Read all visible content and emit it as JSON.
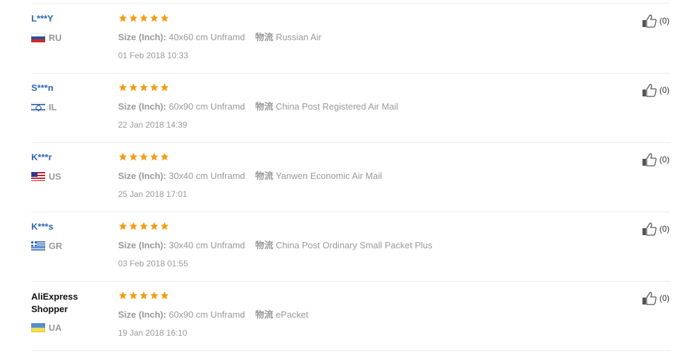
{
  "reviews": [
    {
      "user": "L***Y",
      "country": "RU",
      "flag": "ru-flag-icon",
      "rating": 5,
      "size_label": "Size (Inch):",
      "size_value": "40x60 cm Unframd",
      "logistics_label": "物流",
      "logistics_value": "Russian Air",
      "date": "01 Feb 2018 10:33",
      "helpful": "(0)"
    },
    {
      "user": "S***n",
      "country": "IL",
      "flag": "il-flag-icon",
      "rating": 5,
      "size_label": "Size (Inch):",
      "size_value": "60x90 cm Unframd",
      "logistics_label": "物流",
      "logistics_value": "China Post Registered Air Mail",
      "date": "22 Jan 2018 14:39",
      "helpful": "(0)"
    },
    {
      "user": "K***r",
      "country": "US",
      "flag": "us-flag-icon",
      "rating": 5,
      "size_label": "Size (Inch):",
      "size_value": "30x40 cm Unframd",
      "logistics_label": "物流",
      "logistics_value": "Yanwen Economic Air Mail",
      "date": "25 Jan 2018 17:01",
      "helpful": "(0)"
    },
    {
      "user": "K***s",
      "country": "GR",
      "flag": "gr-flag-icon",
      "rating": 5,
      "size_label": "Size (Inch):",
      "size_value": "30x40 cm Unframd",
      "logistics_label": "物流",
      "logistics_value": "China Post Ordinary Small Packet Plus",
      "date": "03 Feb 2018 01:55",
      "helpful": "(0)"
    },
    {
      "user": "AliExpress Shopper",
      "country": "UA",
      "flag": "ua-flag-icon",
      "rating": 5,
      "size_label": "Size (Inch):",
      "size_value": "60x90 cm Unframd",
      "logistics_label": "物流",
      "logistics_value": "ePacket",
      "date": "19 Jan 2018 16:10",
      "helpful": "(0)"
    }
  ],
  "colors": {
    "star": "#f39c12",
    "username": "#2e66b0",
    "muted": "#999999",
    "divider": "#ebebeb"
  }
}
